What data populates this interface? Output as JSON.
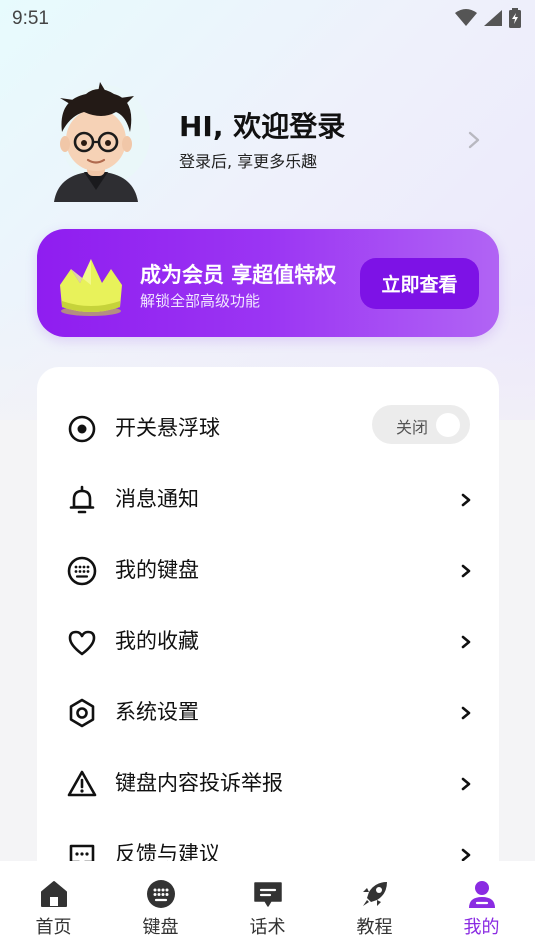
{
  "status_bar": {
    "time": "9:51"
  },
  "profile": {
    "greeting": "HI, 欢迎登录",
    "subtitle": "登录后, 享更多乐趣"
  },
  "vip": {
    "title": "成为会员 享超值特权",
    "subtitle": "解锁全部高级功能",
    "button_label": "立即查看"
  },
  "menu": {
    "items": [
      {
        "label": "开关悬浮球",
        "icon": "target-icon",
        "toggle_label": "关闭",
        "toggle_on": false
      },
      {
        "label": "消息通知",
        "icon": "bell-icon"
      },
      {
        "label": "我的键盘",
        "icon": "keyboard-icon"
      },
      {
        "label": "我的收藏",
        "icon": "heart-icon"
      },
      {
        "label": "系统设置",
        "icon": "settings-hexagon-icon"
      },
      {
        "label": "键盘内容投诉举报",
        "icon": "warning-icon"
      },
      {
        "label": "反馈与建议",
        "icon": "feedback-icon"
      }
    ]
  },
  "bottom_nav": {
    "items": [
      {
        "label": "首页",
        "icon": "home-icon"
      },
      {
        "label": "键盘",
        "icon": "keyboard-icon"
      },
      {
        "label": "话术",
        "icon": "chat-icon"
      },
      {
        "label": "教程",
        "icon": "rocket-icon"
      },
      {
        "label": "我的",
        "icon": "user-icon",
        "active": true
      }
    ]
  },
  "colors": {
    "accent": "#8a2be2",
    "vip_gradient_start": "#8f1df0",
    "vip_gradient_end": "#b164f4",
    "vip_button": "#7d12e6",
    "crown": "#e8f25a"
  }
}
